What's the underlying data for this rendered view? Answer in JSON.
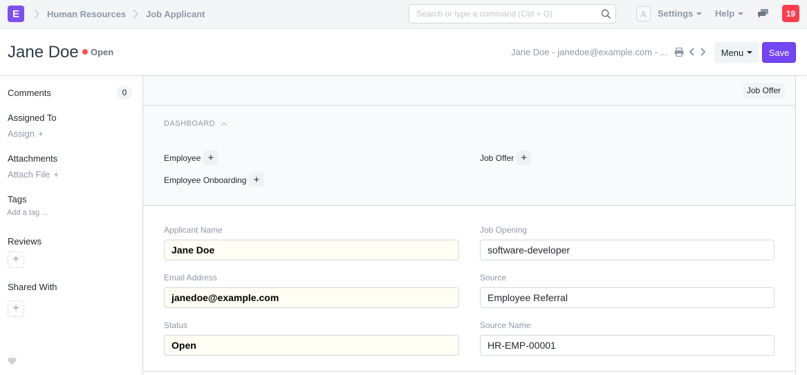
{
  "navbar": {
    "logo_letter": "E",
    "breadcrumbs": [
      "Human Resources",
      "Job Applicant"
    ],
    "search_placeholder": "Search or type a command (Ctrl + G)",
    "avatar_letter": "A",
    "settings_label": "Settings",
    "help_label": "Help",
    "notification_count": "19"
  },
  "page": {
    "title": "Jane Doe",
    "status": "Open",
    "status_color": "#ff4d4d",
    "doc_reference": "Jane Doe - janedoe@example.com - ...",
    "menu_label": "Menu",
    "save_label": "Save",
    "accent_color": "#7445f5"
  },
  "sidebar": {
    "comments_label": "Comments",
    "comments_count": "0",
    "assigned_to_label": "Assigned To",
    "assign_link": "Assign",
    "attachments_label": "Attachments",
    "attach_link": "Attach File",
    "tags_label": "Tags",
    "add_tag_link": "Add a tag ...",
    "reviews_label": "Reviews",
    "shared_with_label": "Shared With"
  },
  "toolbar": {
    "job_offer_button": "Job Offer"
  },
  "dashboard": {
    "heading": "DASHBOARD",
    "links": [
      {
        "label": "Employee"
      },
      {
        "label": "Employee Onboarding"
      },
      {
        "label": "Job Offer"
      }
    ]
  },
  "form": {
    "fields": [
      {
        "label": "Applicant Name",
        "value": "Jane Doe"
      },
      {
        "label": "Email Address",
        "value": "janedoe@example.com"
      },
      {
        "label": "Status",
        "value": "Open"
      },
      {
        "label": "Job Opening",
        "value": "software-developer"
      },
      {
        "label": "Source",
        "value": "Employee Referral"
      },
      {
        "label": "Source Name",
        "value": "HR-EMP-00001"
      }
    ]
  }
}
